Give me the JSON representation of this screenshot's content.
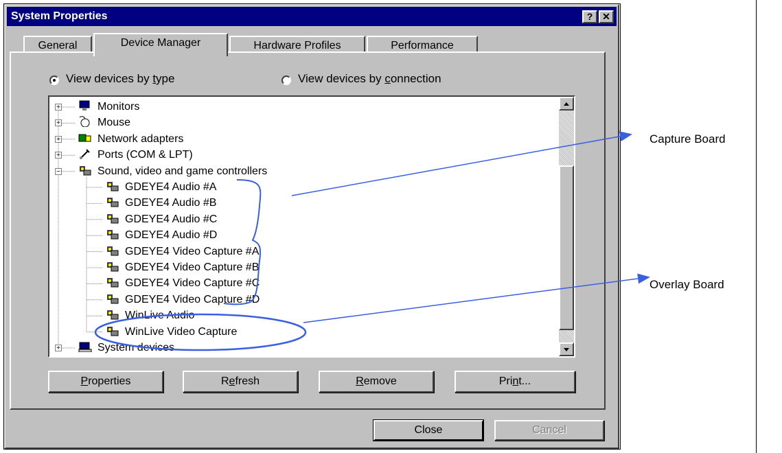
{
  "window": {
    "title": "System Properties",
    "help_glyph": "?",
    "close_glyph": "✕"
  },
  "tabs": [
    {
      "label": "General"
    },
    {
      "label": "Device Manager",
      "active": true
    },
    {
      "label": "Hardware Profiles"
    },
    {
      "label": "Performance"
    }
  ],
  "view_options": {
    "by_type": {
      "pre": "View devices by ",
      "key": "t",
      "post": "ype",
      "selected": true
    },
    "by_connection": {
      "pre": "View devices by ",
      "key": "c",
      "post": "onnection",
      "selected": false
    }
  },
  "device_tree": [
    {
      "label": "Monitors",
      "icon": "monitor-icon",
      "expander": "+"
    },
    {
      "label": "Mouse",
      "icon": "mouse-icon",
      "expander": "+"
    },
    {
      "label": "Network adapters",
      "icon": "network-adapter-icon",
      "expander": "+"
    },
    {
      "label": "Ports (COM & LPT)",
      "icon": "port-icon",
      "expander": "+"
    },
    {
      "label": "Sound, video and game controllers",
      "icon": "multimedia-icon",
      "expander": "−"
    },
    {
      "label": "GDEYE4 Audio #A",
      "icon": "multimedia-icon"
    },
    {
      "label": "GDEYE4 Audio #B",
      "icon": "multimedia-icon"
    },
    {
      "label": "GDEYE4 Audio #C",
      "icon": "multimedia-icon"
    },
    {
      "label": "GDEYE4 Audio #D",
      "icon": "multimedia-icon"
    },
    {
      "label": "GDEYE4 Video Capture #A",
      "icon": "multimedia-icon"
    },
    {
      "label": "GDEYE4 Video Capture #B",
      "icon": "multimedia-icon"
    },
    {
      "label": "GDEYE4 Video Capture #C",
      "icon": "multimedia-icon"
    },
    {
      "label": "GDEYE4 Video Capture #D",
      "icon": "multimedia-icon"
    },
    {
      "label": "WinLive Audio",
      "icon": "multimedia-icon"
    },
    {
      "label": "WinLive Video Capture",
      "icon": "multimedia-icon"
    },
    {
      "label": "System devices",
      "icon": "computer-icon",
      "expander": "+"
    }
  ],
  "actions": {
    "properties": {
      "pre": "",
      "key": "P",
      "post": "roperties"
    },
    "refresh": {
      "pre": "R",
      "key": "e",
      "post": "fresh"
    },
    "remove": {
      "pre": "",
      "key": "R",
      "post": "emove"
    },
    "print": {
      "pre": "Pri",
      "key": "n",
      "post": "t..."
    }
  },
  "footer": {
    "close_label": "Close",
    "cancel_label": "Cancel"
  },
  "annotations": {
    "capture_board": "Capture Board",
    "overlay_board": "Overlay Board",
    "accent_color": "#3a5fe0"
  }
}
